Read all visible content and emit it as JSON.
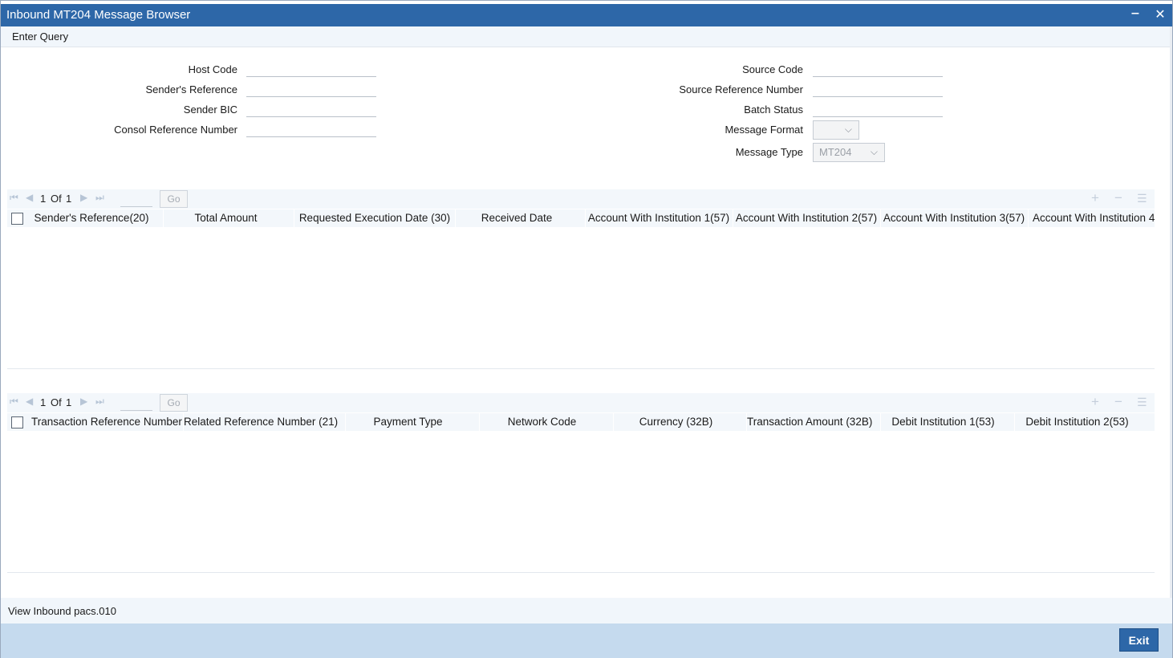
{
  "window": {
    "title": "Inbound MT204 Message Browser",
    "minimize_label": "‒",
    "close_label": "✕"
  },
  "menu": {
    "enter_query": "Enter Query"
  },
  "form": {
    "host_code": {
      "label": "Host Code",
      "value": ""
    },
    "senders_reference": {
      "label": "Sender's Reference",
      "value": ""
    },
    "sender_bic": {
      "label": "Sender BIC",
      "value": ""
    },
    "consol_reference_number": {
      "label": "Consol Reference Number",
      "value": ""
    },
    "source_code": {
      "label": "Source Code",
      "value": ""
    },
    "source_reference_number": {
      "label": "Source Reference Number",
      "value": ""
    },
    "batch_status": {
      "label": "Batch Status",
      "value": ""
    },
    "message_format": {
      "label": "Message Format",
      "value": ""
    },
    "message_type": {
      "label": "Message Type",
      "value": "MT204"
    }
  },
  "grid1": {
    "pager": {
      "current": "1",
      "of_label": "Of",
      "total": "1",
      "go_label": "Go"
    },
    "columns": [
      "Sender's Reference(20)",
      "Total Amount",
      "Requested Execution Date (30)",
      "Received Date",
      "Account With Institution 1(57)",
      "Account With Institution 2(57)",
      "Account With Institution 3(57)",
      "Account With Institution 4("
    ],
    "rows": []
  },
  "grid2": {
    "pager": {
      "current": "1",
      "of_label": "Of",
      "total": "1",
      "go_label": "Go"
    },
    "columns": [
      "Transaction Reference Number",
      "Related Reference Number (21)",
      "Payment Type",
      "Network Code",
      "Currency (32B)",
      "Transaction Amount (32B)",
      "Debit Institution 1(53)",
      "Debit Institution 2(53)"
    ],
    "rows": []
  },
  "footer": {
    "view_link": "View Inbound pacs.010",
    "exit_label": "Exit"
  },
  "icons": {
    "first": "⏮",
    "prev": "◀",
    "next": "▶",
    "last": "⏭",
    "add": "+",
    "remove": "−",
    "list": "☰",
    "chevron": "⌵"
  },
  "colors": {
    "titlebar": "#2d67a8",
    "footer": "#c5daee",
    "header_bg": "#f3f7fb"
  }
}
